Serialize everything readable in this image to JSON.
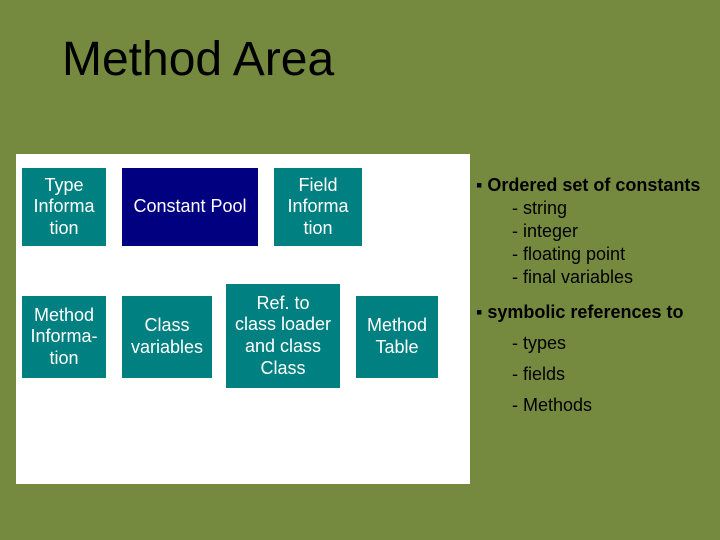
{
  "title": "Method Area",
  "boxes": {
    "type": "Type\nInforma\ntion",
    "const": "Constant Pool",
    "field": "Field\nInforma\ntion",
    "method": "Method\nInforma-\ntion",
    "classvars": "Class\nvariables",
    "ref": "Ref. to\nclass loader\nand class\nClass",
    "table": "Method\nTable"
  },
  "right": {
    "b1": "Ordered set of constants",
    "b1_items": [
      "- string",
      "- integer",
      "- floating point",
      "- final variables"
    ],
    "b2": "symbolic references to",
    "b2_items": [
      "- types",
      "- fields",
      "- Methods"
    ]
  }
}
